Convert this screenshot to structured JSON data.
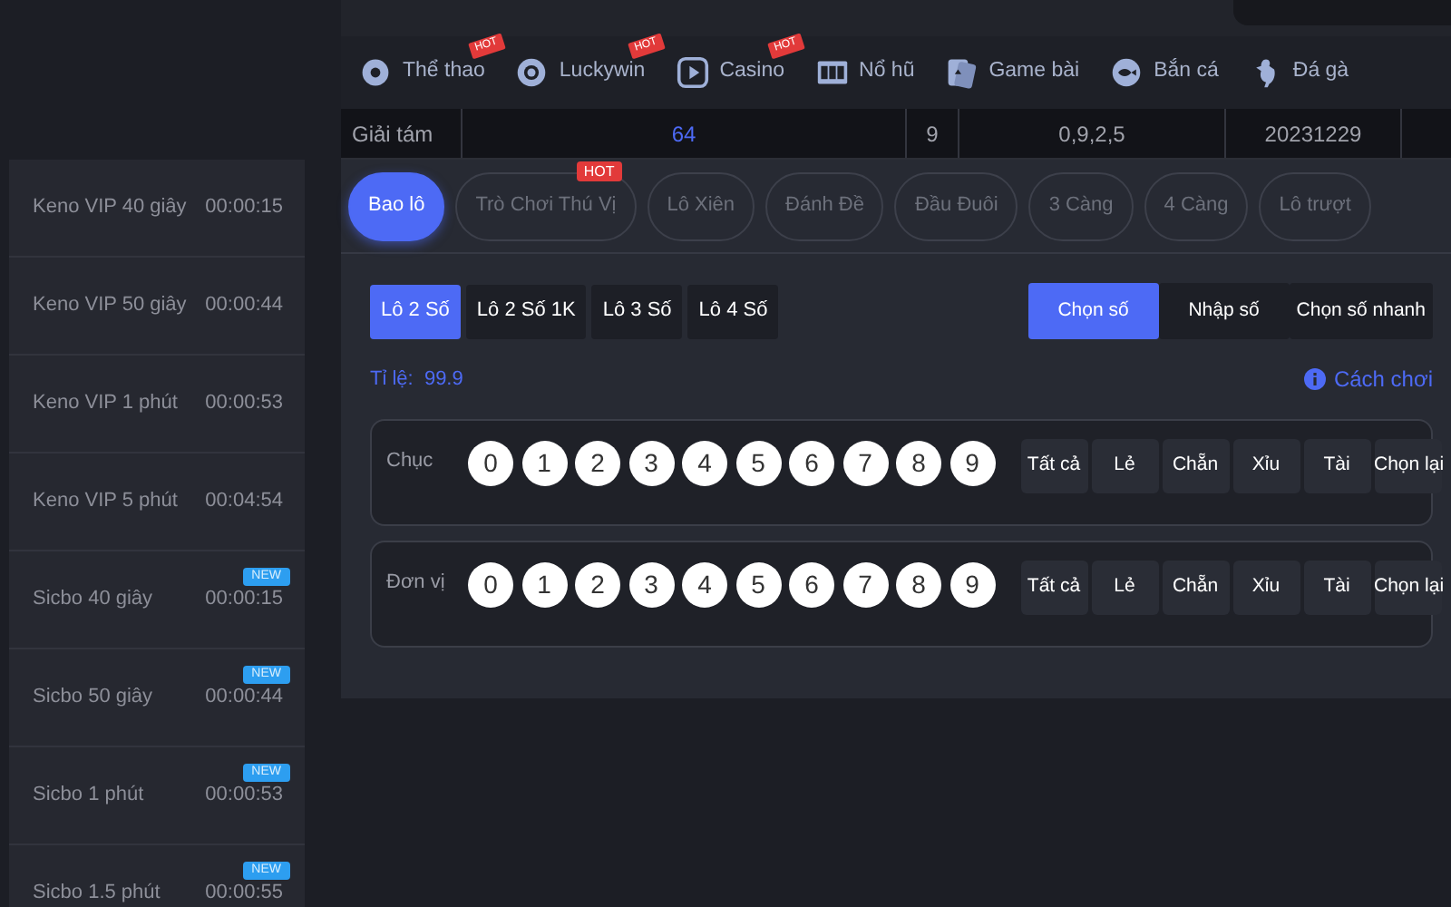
{
  "nav": [
    {
      "label": "Thể thao",
      "badge": "HOT"
    },
    {
      "label": "Luckywin",
      "badge": "HOT"
    },
    {
      "label": "Casino",
      "badge": "HOT"
    },
    {
      "label": "Nổ hũ"
    },
    {
      "label": "Game bài"
    },
    {
      "label": "Bắn cá"
    },
    {
      "label": "Đá gà"
    }
  ],
  "results": [
    "Giải tám",
    "64",
    "9",
    "0,9,2,5",
    "20231229"
  ],
  "sidebar": [
    {
      "name": "Keno VIP 40 giây",
      "time": "00:00:15"
    },
    {
      "name": "Keno VIP 50 giây",
      "time": "00:00:44"
    },
    {
      "name": "Keno VIP 1 phút",
      "time": "00:00:53"
    },
    {
      "name": "Keno VIP 5 phút",
      "time": "00:04:54"
    },
    {
      "name": "Sicbo 40 giây",
      "time": "00:00:15",
      "badge": "NEW"
    },
    {
      "name": "Sicbo 50 giây",
      "time": "00:00:44",
      "badge": "NEW"
    },
    {
      "name": "Sicbo 1 phút",
      "time": "00:00:53",
      "badge": "NEW"
    },
    {
      "name": "Sicbo 1.5 phút",
      "time": "00:00:55",
      "badge": "NEW"
    }
  ],
  "tabs": [
    {
      "label": "Bao lô",
      "selected": true
    },
    {
      "label": "Trò Chơi Thú Vị",
      "selected": false,
      "badge": "HOT"
    },
    {
      "label": "Lô Xiên",
      "selected": false
    },
    {
      "label": "Đánh Đề",
      "selected": false
    },
    {
      "label": "Đầu Đuôi",
      "selected": false
    },
    {
      "label": "3 Càng",
      "selected": false
    },
    {
      "label": "4 Càng",
      "selected": false
    },
    {
      "label": "Lô trượt",
      "selected": false
    }
  ],
  "subtabs": [
    {
      "label": "Lô 2 Số",
      "selected": true
    },
    {
      "label": "Lô 2 Số 1K",
      "selected": false
    },
    {
      "label": "Lô 3 Số",
      "selected": false
    },
    {
      "label": "Lô 4 Số",
      "selected": false
    }
  ],
  "modes": [
    {
      "label": "Chọn số",
      "selected": true
    },
    {
      "label": "Nhập số",
      "selected": false
    },
    {
      "label": "Chọn số nhanh",
      "selected": false
    }
  ],
  "odds": {
    "label": "Tỉ lệ:",
    "value": "99.9"
  },
  "help_link": "Cách chơi",
  "number_rows": [
    {
      "label": "Chục",
      "digits": [
        "0",
        "1",
        "2",
        "3",
        "4",
        "5",
        "6",
        "7",
        "8",
        "9"
      ],
      "actions": [
        "Tất cả",
        "Lẻ",
        "Chẵn",
        "Xỉu",
        "Tài",
        "Chọn lại"
      ]
    },
    {
      "label": "Đơn vị",
      "digits": [
        "0",
        "1",
        "2",
        "3",
        "4",
        "5",
        "6",
        "7",
        "8",
        "9"
      ],
      "actions": [
        "Tất cả",
        "Lẻ",
        "Chẵn",
        "Xỉu",
        "Tài",
        "Chọn lại"
      ]
    }
  ]
}
